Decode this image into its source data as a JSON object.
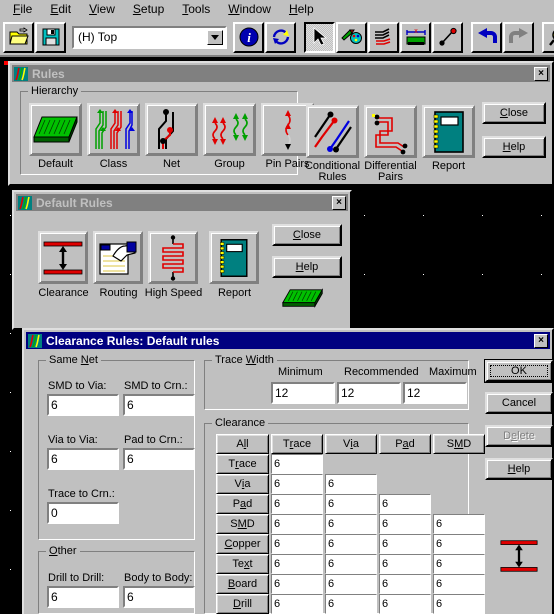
{
  "menu": {
    "items": [
      {
        "label": "File",
        "accel": "F"
      },
      {
        "label": "Edit",
        "accel": "E"
      },
      {
        "label": "View",
        "accel": "V"
      },
      {
        "label": "Setup",
        "accel": "S"
      },
      {
        "label": "Tools",
        "accel": "T"
      },
      {
        "label": "Window",
        "accel": "W"
      },
      {
        "label": "Help",
        "accel": "H"
      }
    ]
  },
  "toolbar": {
    "layer_combo_value": "(H) Top",
    "buttons": [
      {
        "name": "open-file-button",
        "icon": "folder-open-icon"
      },
      {
        "name": "save-file-button",
        "icon": "floppy-disk-icon"
      },
      {
        "name": "info-button",
        "icon": "info-circle-icon"
      },
      {
        "name": "refresh-button",
        "icon": "refresh-arrows-icon"
      },
      {
        "name": "select-tool-button",
        "icon": "arrow-cursor-icon"
      },
      {
        "name": "color-settings-button",
        "icon": "palette-icon"
      },
      {
        "name": "route-traces-button",
        "icon": "traces-icon"
      },
      {
        "name": "board-outline-button",
        "icon": "board-measure-icon"
      },
      {
        "name": "connection-line-button",
        "icon": "ratsnest-icon"
      },
      {
        "name": "undo-button",
        "icon": "undo-arrow-icon"
      },
      {
        "name": "redo-button",
        "icon": "redo-arrow-icon"
      },
      {
        "name": "zoom-button",
        "icon": "magnifier-plus-icon"
      }
    ]
  },
  "rules_window": {
    "title": "Rules",
    "active": false,
    "group_label": "Hierarchy",
    "group_accel": "",
    "hierarchy_tiles": [
      {
        "label": "Default",
        "icon": "pcb-board-icon"
      },
      {
        "label": "Class",
        "icon": "net-class-traces-icon"
      },
      {
        "label": "Net",
        "icon": "single-net-icon"
      },
      {
        "label": "Group",
        "icon": "net-group-icon"
      },
      {
        "label": "Pin Pairs",
        "icon": "pin-pairs-icon"
      }
    ],
    "extra_tiles": [
      {
        "label": "Conditional\nRules",
        "icon": "conditional-rules-icon"
      },
      {
        "label": "Differential\nPairs",
        "icon": "differential-pairs-icon"
      },
      {
        "label": "Report",
        "icon": "report-book-icon"
      }
    ],
    "close_label": "Close",
    "close_accel": "C",
    "help_label": "Help",
    "help_accel": "H",
    "close_box": "×"
  },
  "default_rules_window": {
    "title": "Default Rules",
    "active": false,
    "tiles": [
      {
        "label": "Clearance",
        "icon": "clearance-arrows-icon"
      },
      {
        "label": "Routing",
        "icon": "routing-hand-icon"
      },
      {
        "label": "High Speed",
        "icon": "high-speed-coil-icon"
      },
      {
        "label": "Report",
        "icon": "report-book-icon"
      }
    ],
    "decor_icon": "pcb-board-icon",
    "close_label": "Close",
    "close_accel": "C",
    "help_label": "Help",
    "help_accel": "H",
    "close_box": "×"
  },
  "clearance_window": {
    "title": "Clearance Rules: Default rules",
    "active": true,
    "close_box": "×",
    "same_net": {
      "group_label": "Same Net",
      "group_accel": "N",
      "fields": [
        {
          "name": "smd-to-via-field",
          "label": "SMD to Via:",
          "value": "6"
        },
        {
          "name": "smd-to-crn-field",
          "label": "SMD to Crn.:",
          "value": "6"
        },
        {
          "name": "via-to-via-field",
          "label": "Via to Via:",
          "value": "6"
        },
        {
          "name": "pad-to-crn-field",
          "label": "Pad to Crn.:",
          "value": "6"
        },
        {
          "name": "trace-to-crn-field",
          "label": "Trace to Crn.:",
          "value": "0"
        }
      ]
    },
    "other": {
      "group_label": "Other",
      "group_accel": "O",
      "fields": [
        {
          "name": "drill-to-drill-field",
          "label": "Drill to Drill:",
          "value": "6"
        },
        {
          "name": "body-to-body-field",
          "label": "Body to Body:",
          "value": "6"
        }
      ]
    },
    "trace_width": {
      "group_label": "Trace Width",
      "group_accel": "W",
      "columns": [
        "Minimum",
        "Recommended",
        "Maximum"
      ],
      "values": [
        "12",
        "12",
        "12"
      ]
    },
    "clearance_matrix": {
      "group_label": "Clearance",
      "corner_label": "All",
      "corner_accel": "l",
      "columns": [
        {
          "label": "Trace",
          "accel": "r"
        },
        {
          "label": "Via",
          "accel": "i"
        },
        {
          "label": "Pad",
          "accel": "a"
        },
        {
          "label": "SMD",
          "accel": "M"
        }
      ],
      "rows": [
        {
          "label": "Trace",
          "accel": "r",
          "values": [
            "6"
          ]
        },
        {
          "label": "Via",
          "accel": "i",
          "values": [
            "6",
            "6"
          ]
        },
        {
          "label": "Pad",
          "accel": "a",
          "values": [
            "6",
            "6",
            "6"
          ]
        },
        {
          "label": "SMD",
          "accel": "M",
          "values": [
            "6",
            "6",
            "6",
            "6"
          ]
        },
        {
          "label": "Copper",
          "accel": "C",
          "values": [
            "6",
            "6",
            "6",
            "6"
          ]
        },
        {
          "label": "Text",
          "accel": "x",
          "values": [
            "6",
            "6",
            "6",
            "6"
          ]
        },
        {
          "label": "Board",
          "accel": "B",
          "values": [
            "6",
            "6",
            "6",
            "6"
          ]
        },
        {
          "label": "Drill",
          "accel": "D",
          "values": [
            "6",
            "6",
            "6",
            "6"
          ]
        }
      ]
    },
    "buttons": [
      {
        "name": "ok-button",
        "label": "OK",
        "accel": "",
        "default": true,
        "disabled": false
      },
      {
        "name": "cancel-button",
        "label": "Cancel",
        "accel": "",
        "default": false,
        "disabled": false
      },
      {
        "name": "delete-button",
        "label": "Delete",
        "accel": "e",
        "default": false,
        "disabled": true
      },
      {
        "name": "help-button",
        "label": "Help",
        "accel": "H",
        "default": false,
        "disabled": false
      }
    ],
    "preview_icon": "clearance-arrows-icon"
  },
  "colors": {
    "face": "#c0c0c0",
    "active_title": "#000080",
    "inactive_title": "#808080",
    "canvas": "#000000",
    "accent_red": "#ff0000",
    "accent_green": "#00b000",
    "accent_teal": "#008080"
  }
}
